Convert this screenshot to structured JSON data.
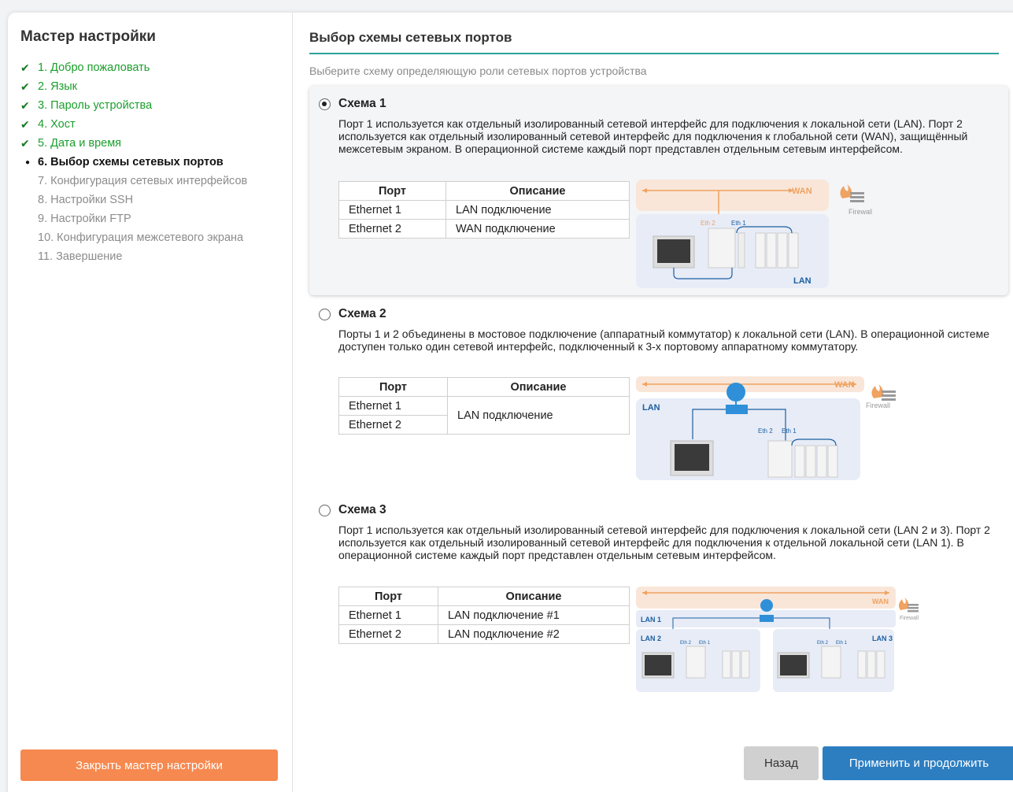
{
  "sidebar": {
    "title": "Мастер настройки",
    "steps": [
      {
        "label": "1. Добро пожаловать",
        "state": "done"
      },
      {
        "label": "2. Язык",
        "state": "done"
      },
      {
        "label": "3. Пароль устройства",
        "state": "done"
      },
      {
        "label": "4. Хост",
        "state": "done"
      },
      {
        "label": "5. Дата и время",
        "state": "done"
      },
      {
        "label": "6. Выбор схемы сетевых портов",
        "state": "current"
      },
      {
        "label": "7. Конфигурация сетевых интерфейсов",
        "state": "todo"
      },
      {
        "label": "8. Настройки SSH",
        "state": "todo"
      },
      {
        "label": "9. Настройки FTP",
        "state": "todo"
      },
      {
        "label": "10. Конфигурация межсетевого экрана",
        "state": "todo"
      },
      {
        "label": "11. Завершение",
        "state": "todo"
      }
    ],
    "close_label": "Закрыть мастер настройки"
  },
  "main": {
    "title": "Выбор схемы сетевых портов",
    "subtitle": "Выберите схему определяющую роли сетевых портов устройства",
    "table_headers": {
      "port": "Порт",
      "desc": "Описание"
    },
    "schemes": [
      {
        "name": "Схема 1",
        "selected": true,
        "description": "Порт 1 используется как отдельный изолированный сетевой интерфейс для подключения к локальной сети (LAN). Порт 2 используется как отдельный изолированный сетевой интерфейс для подключения к глобальной сети (WAN), защищённый межсетевым экраном. В операционной системе каждый порт представлен отдельным сетевым интерфейсом.",
        "rows": [
          {
            "port": "Ethernet 1",
            "desc": "LAN подключение"
          },
          {
            "port": "Ethernet 2",
            "desc": "WAN подключение"
          }
        ],
        "diagram": {
          "wan": "WAN",
          "lan": "LAN",
          "firewall": "Firewall",
          "eth2": "Eth 2",
          "eth1": "Eth 1"
        }
      },
      {
        "name": "Схема 2",
        "selected": false,
        "description": "Порты 1 и 2 объединены в мостовое подключение (аппаратный коммутатор) к локальной сети (LAN). В операционной системе доступен только один сетевой интерфейс, подключенный к 3-х портовому аппаратному коммутатору.",
        "rows": [
          {
            "port": "Ethernet 1"
          },
          {
            "port": "Ethernet 2"
          }
        ],
        "merged_desc": "LAN подключение",
        "diagram": {
          "wan": "WAN",
          "lan": "LAN",
          "firewall": "Firewall",
          "eth2": "Eth 2",
          "eth1": "Eth 1"
        }
      },
      {
        "name": "Схема 3",
        "selected": false,
        "description": "Порт 1 используется как отдельный изолированный сетевой интерфейс для подключения к локальной сети (LAN 2 и 3). Порт 2 используется как отдельный изолированный сетевой интерфейс для подключения к отдельной локальной сети (LAN 1). В операционной системе каждый порт представлен отдельным сетевым интерфейсом.",
        "rows": [
          {
            "port": "Ethernet 1",
            "desc": "LAN подключение #1"
          },
          {
            "port": "Ethernet 2",
            "desc": "LAN подключение #2"
          }
        ],
        "diagram": {
          "wan": "WAN",
          "lan1": "LAN 1",
          "lan2": "LAN 2",
          "lan3": "LAN 3",
          "firewall": "Firewall",
          "eth2": "Eth 2",
          "eth1": "Eth 1"
        }
      }
    ],
    "back_label": "Назад",
    "apply_label": "Применить и продолжить"
  },
  "colors": {
    "accent_green": "#1a9e2c",
    "rule": "#2aa39a",
    "close": "#f6894f",
    "apply": "#2d7ec1",
    "wan": "#f0a260",
    "lan_text": "#1d5fa0"
  }
}
